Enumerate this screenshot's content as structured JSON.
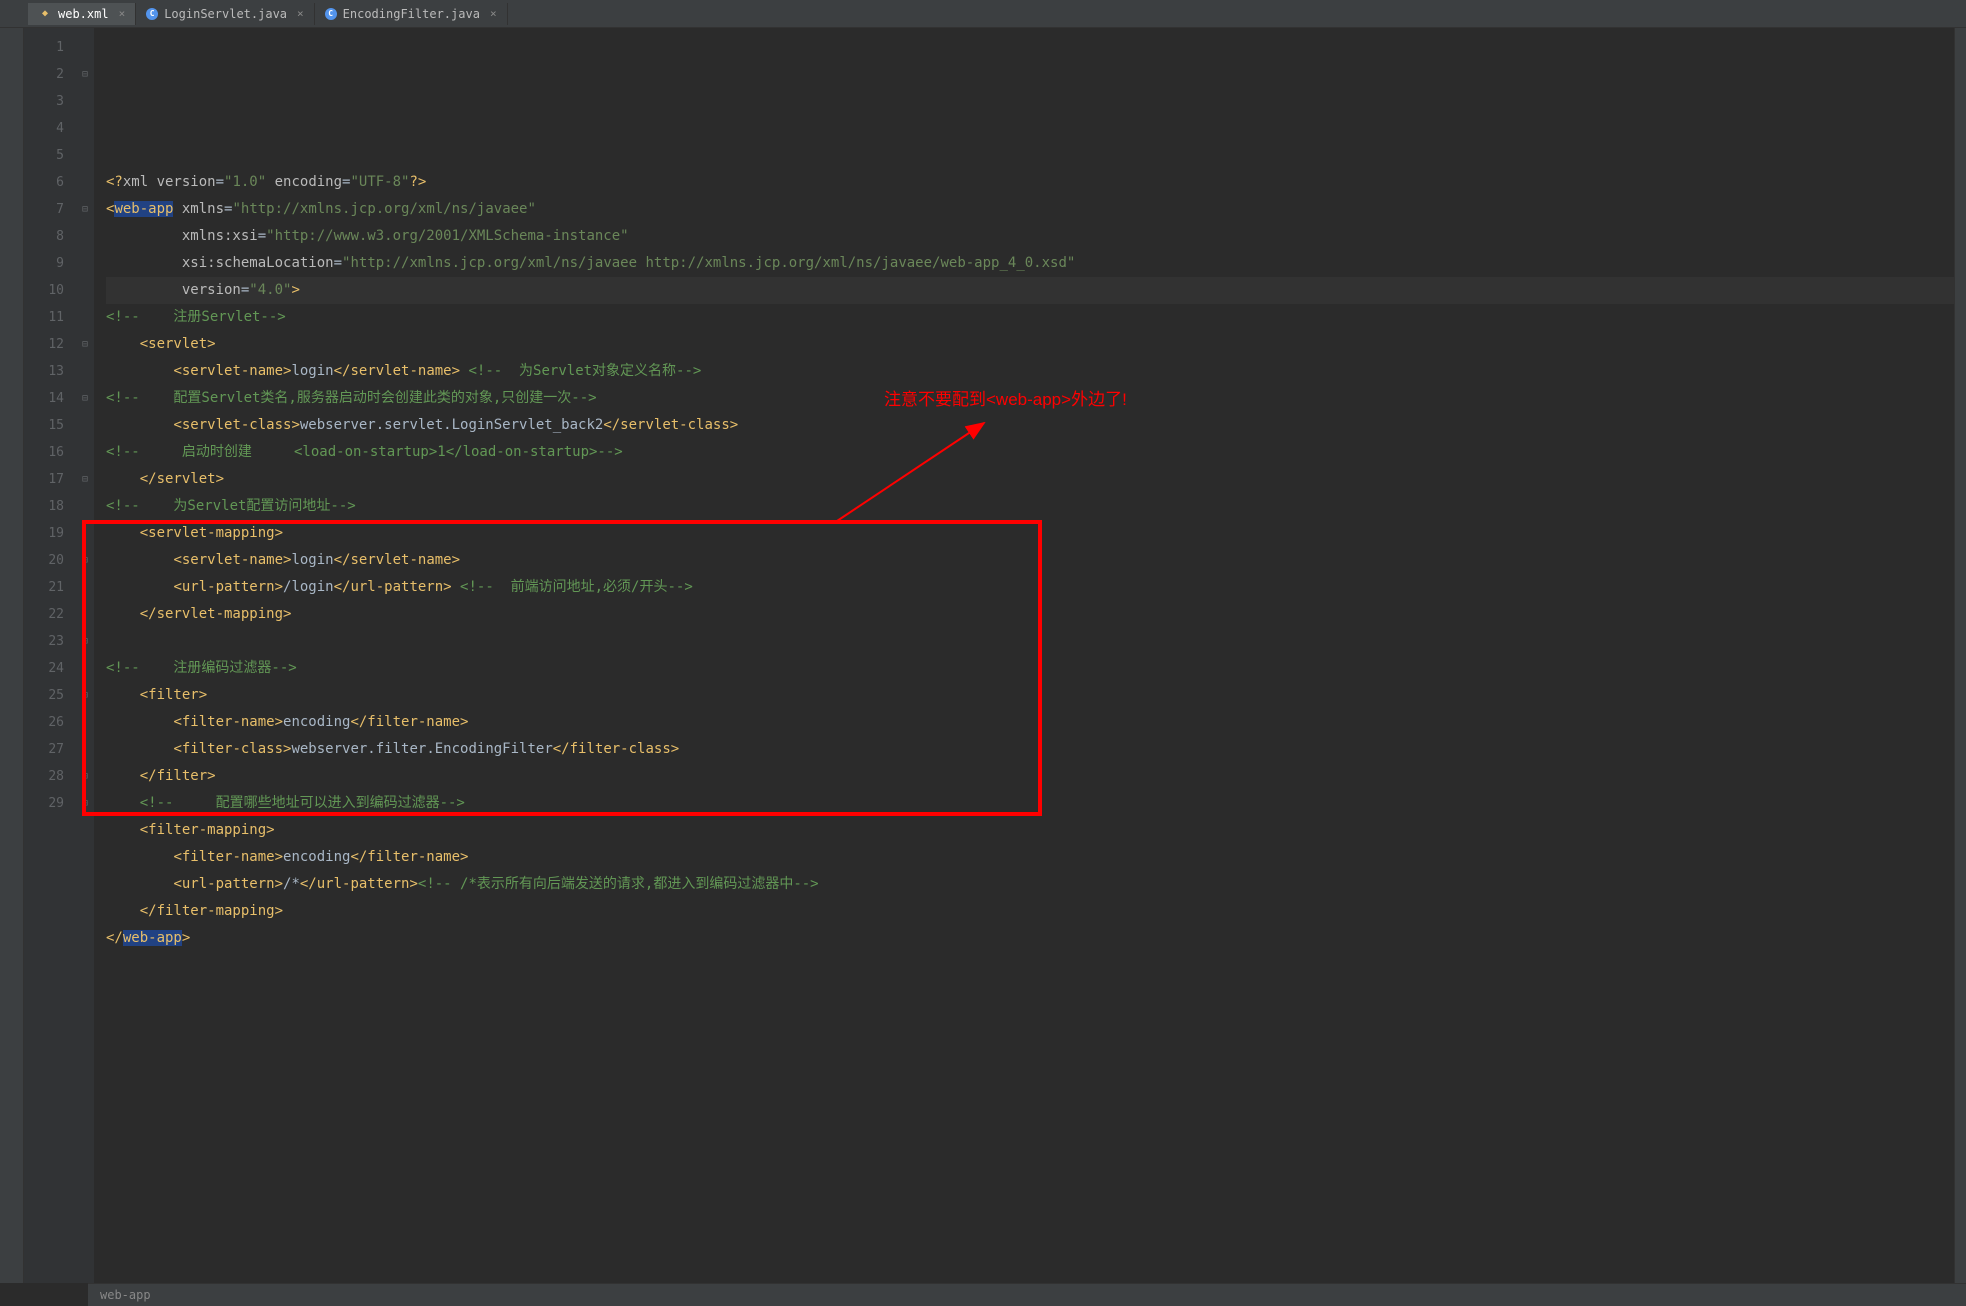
{
  "tabs": [
    {
      "label": "web.xml",
      "icon": "xml",
      "active": true
    },
    {
      "label": "LoginServlet.java",
      "icon": "java",
      "active": false
    },
    {
      "label": "EncodingFilter.java",
      "icon": "java",
      "active": false
    }
  ],
  "lines": [
    {
      "n": "1",
      "fold": "",
      "segments": [
        {
          "t": "<?",
          "c": "tk-tag"
        },
        {
          "t": "xml version",
          "c": "tk-attr"
        },
        {
          "t": "=",
          "c": "tk-text"
        },
        {
          "t": "\"1.0\"",
          "c": "tk-string"
        },
        {
          "t": " encoding",
          "c": "tk-attr"
        },
        {
          "t": "=",
          "c": "tk-text"
        },
        {
          "t": "\"UTF-8\"",
          "c": "tk-string"
        },
        {
          "t": "?>",
          "c": "tk-tag"
        }
      ]
    },
    {
      "n": "2",
      "fold": "⊟",
      "segments": [
        {
          "t": "<",
          "c": "tk-tag"
        },
        {
          "t": "web-app",
          "c": "tk-tag tk-hl"
        },
        {
          "t": " xmlns",
          "c": "tk-attr"
        },
        {
          "t": "=",
          "c": "tk-text"
        },
        {
          "t": "\"http://xmlns.jcp.org/xml/ns/javaee\"",
          "c": "tk-string"
        }
      ]
    },
    {
      "n": "3",
      "fold": "",
      "segments": [
        {
          "t": "         xmlns:xsi",
          "c": "tk-attr"
        },
        {
          "t": "=",
          "c": "tk-text"
        },
        {
          "t": "\"http://www.w3.org/2001/XMLSchema-instance\"",
          "c": "tk-string"
        }
      ]
    },
    {
      "n": "4",
      "fold": "",
      "segments": [
        {
          "t": "         xsi",
          "c": "tk-attr"
        },
        {
          "t": ":schemaLocation",
          "c": "tk-attr"
        },
        {
          "t": "=",
          "c": "tk-text"
        },
        {
          "t": "\"http://xmlns.jcp.org/xml/ns/javaee http://xmlns.jcp.org/xml/ns/javaee/web-app_4_0.xsd\"",
          "c": "tk-string"
        }
      ]
    },
    {
      "n": "5",
      "fold": "",
      "hl": true,
      "segments": [
        {
          "t": "         version",
          "c": "tk-attr"
        },
        {
          "t": "=",
          "c": "tk-text"
        },
        {
          "t": "\"4.0\"",
          "c": "tk-string"
        },
        {
          "t": ">",
          "c": "tk-tag"
        }
      ]
    },
    {
      "n": "6",
      "fold": "",
      "segments": [
        {
          "t": "<!--    注册Servlet-->",
          "c": "tk-comment"
        }
      ]
    },
    {
      "n": "7",
      "fold": "⊟",
      "segments": [
        {
          "t": "    ",
          "c": ""
        },
        {
          "t": "<servlet>",
          "c": "tk-tag"
        }
      ]
    },
    {
      "n": "8",
      "fold": "",
      "segments": [
        {
          "t": "        ",
          "c": ""
        },
        {
          "t": "<servlet-name>",
          "c": "tk-tag"
        },
        {
          "t": "login",
          "c": "tk-text"
        },
        {
          "t": "</servlet-name>",
          "c": "tk-tag"
        },
        {
          "t": " ",
          "c": ""
        },
        {
          "t": "<!--  为Servlet对象定义名称-->",
          "c": "tk-comment"
        }
      ]
    },
    {
      "n": "9",
      "fold": "",
      "segments": [
        {
          "t": "<!--    配置Servlet类名,服务器启动时会创建此类的对象,只创建一次-->",
          "c": "tk-comment"
        }
      ]
    },
    {
      "n": "10",
      "fold": "",
      "segments": [
        {
          "t": "        ",
          "c": ""
        },
        {
          "t": "<servlet-class>",
          "c": "tk-tag"
        },
        {
          "t": "webserver.servlet.LoginServlet_back2",
          "c": "tk-text"
        },
        {
          "t": "</servlet-class>",
          "c": "tk-tag"
        }
      ]
    },
    {
      "n": "11",
      "fold": "",
      "segments": [
        {
          "t": "<!--     启动时创建     <load-on-startup>1</load-on-startup>-->",
          "c": "tk-comment"
        }
      ]
    },
    {
      "n": "12",
      "fold": "⊟",
      "segments": [
        {
          "t": "    ",
          "c": ""
        },
        {
          "t": "</servlet>",
          "c": "tk-tag"
        }
      ]
    },
    {
      "n": "13",
      "fold": "",
      "segments": [
        {
          "t": "<!--    为Servlet配置访问地址-->",
          "c": "tk-comment"
        }
      ]
    },
    {
      "n": "14",
      "fold": "⊟",
      "segments": [
        {
          "t": "    ",
          "c": ""
        },
        {
          "t": "<servlet-mapping>",
          "c": "tk-tag"
        }
      ]
    },
    {
      "n": "15",
      "fold": "",
      "segments": [
        {
          "t": "        ",
          "c": ""
        },
        {
          "t": "<servlet-name>",
          "c": "tk-tag"
        },
        {
          "t": "login",
          "c": "tk-text"
        },
        {
          "t": "</servlet-name>",
          "c": "tk-tag"
        }
      ]
    },
    {
      "n": "16",
      "fold": "",
      "segments": [
        {
          "t": "        ",
          "c": ""
        },
        {
          "t": "<url-pattern>",
          "c": "tk-tag"
        },
        {
          "t": "/login",
          "c": "tk-text"
        },
        {
          "t": "</url-pattern>",
          "c": "tk-tag"
        },
        {
          "t": " ",
          "c": ""
        },
        {
          "t": "<!--  前端访问地址,必须/开头-->",
          "c": "tk-comment"
        }
      ]
    },
    {
      "n": "17",
      "fold": "⊟",
      "segments": [
        {
          "t": "    ",
          "c": ""
        },
        {
          "t": "</servlet-mapping>",
          "c": "tk-tag"
        }
      ]
    },
    {
      "n": "18",
      "fold": "",
      "segments": []
    },
    {
      "n": "19",
      "fold": "",
      "segments": [
        {
          "t": "<!--    注册编码过滤器-->",
          "c": "tk-comment"
        }
      ]
    },
    {
      "n": "20",
      "fold": "⊟",
      "segments": [
        {
          "t": "    ",
          "c": ""
        },
        {
          "t": "<filter>",
          "c": "tk-tag"
        }
      ]
    },
    {
      "n": "21",
      "fold": "",
      "segments": [
        {
          "t": "        ",
          "c": ""
        },
        {
          "t": "<filter-name>",
          "c": "tk-tag"
        },
        {
          "t": "encoding",
          "c": "tk-text"
        },
        {
          "t": "</filter-name>",
          "c": "tk-tag"
        }
      ]
    },
    {
      "n": "22",
      "fold": "",
      "segments": [
        {
          "t": "        ",
          "c": ""
        },
        {
          "t": "<filter-class>",
          "c": "tk-tag"
        },
        {
          "t": "webserver.filter.EncodingFilter",
          "c": "tk-text"
        },
        {
          "t": "</filter-class>",
          "c": "tk-tag"
        }
      ]
    },
    {
      "n": "23",
      "fold": "⊟",
      "segments": [
        {
          "t": "    ",
          "c": ""
        },
        {
          "t": "</filter>",
          "c": "tk-tag"
        }
      ]
    },
    {
      "n": "24",
      "fold": "",
      "segments": [
        {
          "t": "    ",
          "c": ""
        },
        {
          "t": "<!--     配置哪些地址可以进入到编码过滤器-->",
          "c": "tk-comment"
        }
      ]
    },
    {
      "n": "25",
      "fold": "⊟",
      "segments": [
        {
          "t": "    ",
          "c": ""
        },
        {
          "t": "<filter-mapping>",
          "c": "tk-tag"
        }
      ]
    },
    {
      "n": "26",
      "fold": "",
      "segments": [
        {
          "t": "        ",
          "c": ""
        },
        {
          "t": "<filter-name>",
          "c": "tk-tag"
        },
        {
          "t": "encoding",
          "c": "tk-text"
        },
        {
          "t": "</filter-name>",
          "c": "tk-tag"
        }
      ]
    },
    {
      "n": "27",
      "fold": "",
      "segments": [
        {
          "t": "        ",
          "c": ""
        },
        {
          "t": "<url-pattern>",
          "c": "tk-tag"
        },
        {
          "t": "/*",
          "c": "tk-text"
        },
        {
          "t": "</url-pattern>",
          "c": "tk-tag"
        },
        {
          "t": "<!-- /*表示所有向后端发送的请求,都进入到编码过滤器中-->",
          "c": "tk-comment"
        }
      ]
    },
    {
      "n": "28",
      "fold": "⊟",
      "segments": [
        {
          "t": "    ",
          "c": ""
        },
        {
          "t": "</filter-mapping>",
          "c": "tk-tag"
        }
      ]
    },
    {
      "n": "29",
      "fold": "⊟",
      "segments": [
        {
          "t": "</",
          "c": "tk-tag"
        },
        {
          "t": "web-app",
          "c": "tk-tag tk-hl"
        },
        {
          "t": ">",
          "c": "tk-tag"
        }
      ]
    },
    {
      "n": "",
      "fold": "",
      "segments": []
    }
  ],
  "annotation": "注意不要配到<web-app>外边了!",
  "breadcrumb": "web-app"
}
